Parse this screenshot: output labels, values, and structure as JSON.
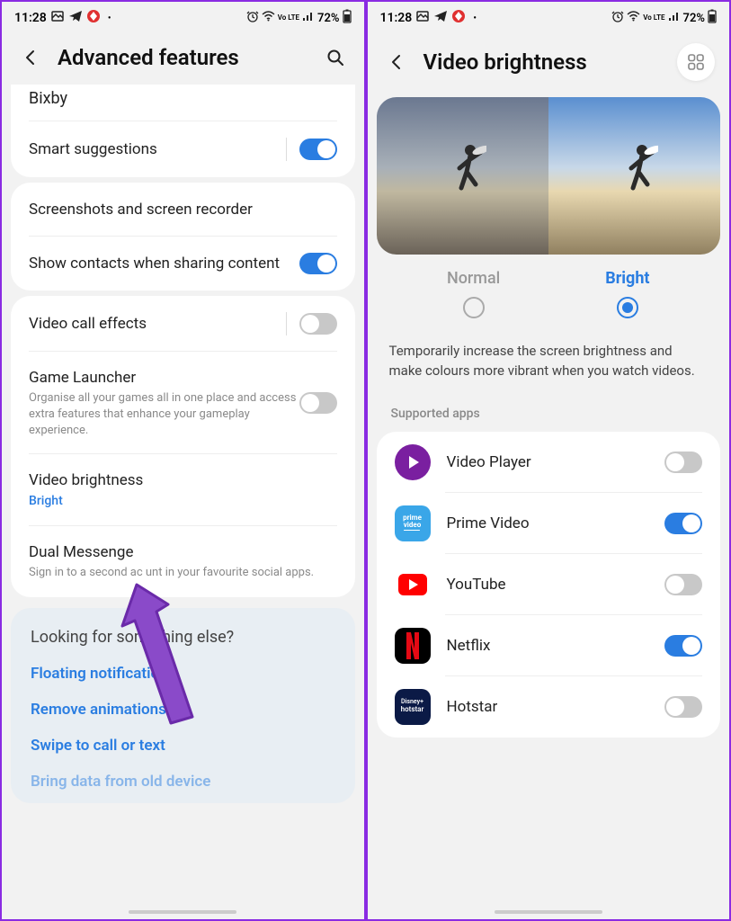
{
  "status": {
    "time": "11:28",
    "battery": "72%",
    "signal": "Vo LTE"
  },
  "left": {
    "title": "Advanced features",
    "card1": {
      "bixby": "Bixby",
      "smart_suggestions": "Smart suggestions"
    },
    "card2": {
      "screenshots": "Screenshots and screen recorder",
      "contacts": "Show contacts when sharing content"
    },
    "card3": {
      "video_call": "Video call effects",
      "game_launcher": {
        "title": "Game Launcher",
        "sub": "Organise all your games all in one place and access extra features that enhance your gameplay experience."
      },
      "video_brightness": {
        "title": "Video brightness",
        "sub": "Bright"
      },
      "dual_messenger": {
        "title": "Dual Messenge",
        "sub": "Sign in to a second ac     unt in your favourite social apps."
      }
    },
    "looking": {
      "title": "Looking for something else?",
      "links": [
        "Floating notifications",
        "Remove animations",
        "Swipe to call or text",
        "Bring data from old device"
      ]
    }
  },
  "right": {
    "title": "Video brightness",
    "radios": {
      "normal": "Normal",
      "bright": "Bright"
    },
    "description": "Temporarily increase the screen brightness and make colours more vibrant when you watch videos.",
    "supported_label": "Supported apps",
    "apps": [
      {
        "name": "Video Player",
        "on": false,
        "color": "#7a1fa0",
        "icon": "play"
      },
      {
        "name": "Prime Video",
        "on": true,
        "color": "#3aa6e8",
        "icon": "prime"
      },
      {
        "name": "YouTube",
        "on": false,
        "color": "#ffffff",
        "icon": "youtube"
      },
      {
        "name": "Netflix",
        "on": true,
        "color": "#000000",
        "icon": "netflix"
      },
      {
        "name": "Hotstar",
        "on": false,
        "color": "#0b1a46",
        "icon": "hotstar"
      }
    ]
  }
}
